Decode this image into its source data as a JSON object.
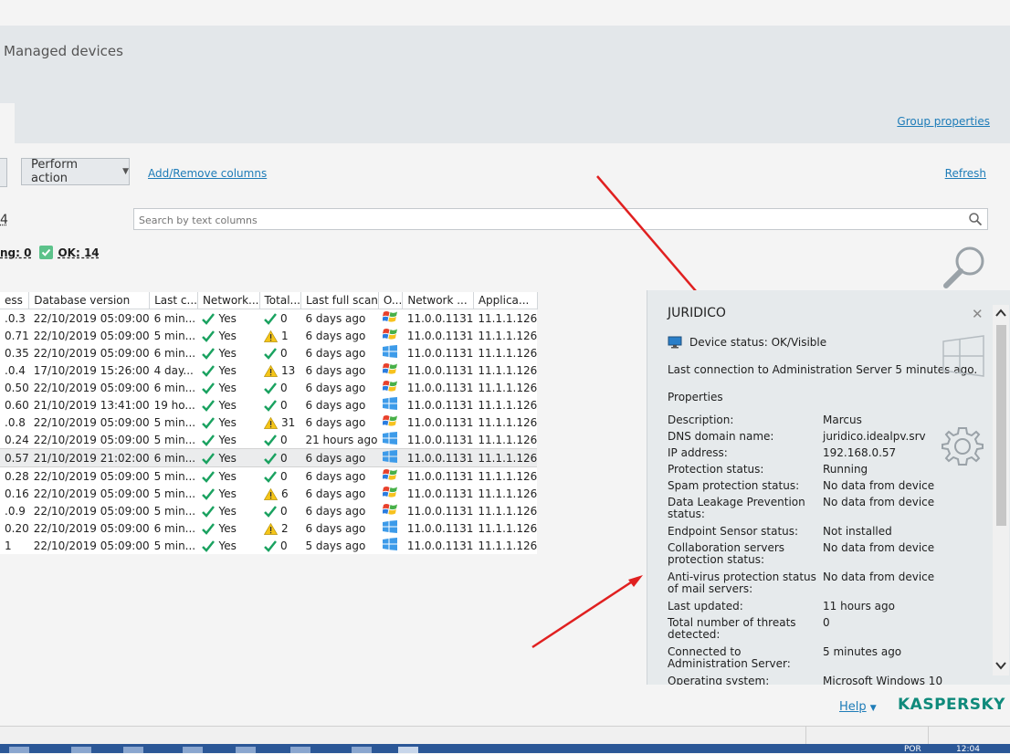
{
  "page": {
    "title": "Managed devices",
    "group_properties": "Group properties",
    "refresh": "Refresh"
  },
  "toolbar": {
    "perform_action": "Perform action",
    "add_remove_columns": "Add/Remove columns",
    "count_fragment": "4"
  },
  "search": {
    "placeholder": "Search by text columns"
  },
  "status_summary": {
    "warning_fragment": "ng: 0",
    "ok": "OK: 14"
  },
  "table": {
    "columns": [
      "ess",
      "Database version",
      "Last c...",
      "Network...",
      "Total...",
      "Last full scan",
      "O...",
      "Network ...",
      "Applica..."
    ],
    "rows": [
      {
        "addr": ".0.3",
        "db": "22/10/2019 05:09:00",
        "last": "6 min...",
        "net": "Yes",
        "st": "ok",
        "total": "0",
        "scan": "6 days ago",
        "os": "xp",
        "nagent": "11.0.0.1131",
        "app": "11.1.1.126"
      },
      {
        "addr": "0.71",
        "db": "22/10/2019 05:09:00",
        "last": "5 min...",
        "net": "Yes",
        "st": "warn",
        "total": "1",
        "scan": "6 days ago",
        "os": "xp",
        "nagent": "11.0.0.1131",
        "app": "11.1.1.126"
      },
      {
        "addr": "0.35",
        "db": "22/10/2019 05:09:00",
        "last": "6 min...",
        "net": "Yes",
        "st": "ok",
        "total": "0",
        "scan": "6 days ago",
        "os": "win10",
        "nagent": "11.0.0.1131",
        "app": "11.1.1.126"
      },
      {
        "addr": ".0.4",
        "db": "17/10/2019 15:26:00",
        "last": "4 day...",
        "net": "Yes",
        "st": "warn",
        "total": "13",
        "scan": "6 days ago",
        "os": "xp",
        "nagent": "11.0.0.1131",
        "app": "11.1.1.126"
      },
      {
        "addr": "0.50",
        "db": "22/10/2019 05:09:00",
        "last": "6 min...",
        "net": "Yes",
        "st": "ok",
        "total": "0",
        "scan": "6 days ago",
        "os": "xp",
        "nagent": "11.0.0.1131",
        "app": "11.1.1.126"
      },
      {
        "addr": "0.60",
        "db": "21/10/2019 13:41:00",
        "last": "19 ho...",
        "net": "Yes",
        "st": "ok",
        "total": "0",
        "scan": "6 days ago",
        "os": "win10",
        "nagent": "11.0.0.1131",
        "app": "11.1.1.126"
      },
      {
        "addr": ".0.8",
        "db": "22/10/2019 05:09:00",
        "last": "5 min...",
        "net": "Yes",
        "st": "warn",
        "total": "31",
        "scan": "6 days ago",
        "os": "xp",
        "nagent": "11.0.0.1131",
        "app": "11.1.1.126"
      },
      {
        "addr": "0.24",
        "db": "22/10/2019 05:09:00",
        "last": "5 min...",
        "net": "Yes",
        "st": "ok",
        "total": "0",
        "scan": "21 hours ago",
        "os": "win10",
        "nagent": "11.0.0.1131",
        "app": "11.1.1.126"
      },
      {
        "addr": "0.57",
        "db": "21/10/2019 21:02:00",
        "last": "6 min...",
        "net": "Yes",
        "st": "ok",
        "total": "0",
        "scan": "6 days ago",
        "os": "win10",
        "nagent": "11.0.0.1131",
        "app": "11.1.1.126",
        "selected": true
      },
      {
        "addr": "0.28",
        "db": "22/10/2019 05:09:00",
        "last": "5 min...",
        "net": "Yes",
        "st": "ok",
        "total": "0",
        "scan": "6 days ago",
        "os": "xp",
        "nagent": "11.0.0.1131",
        "app": "11.1.1.126"
      },
      {
        "addr": "0.16",
        "db": "22/10/2019 05:09:00",
        "last": "5 min...",
        "net": "Yes",
        "st": "warn",
        "total": "6",
        "scan": "6 days ago",
        "os": "xp",
        "nagent": "11.0.0.1131",
        "app": "11.1.1.126"
      },
      {
        "addr": ".0.9",
        "db": "22/10/2019 05:09:00",
        "last": "5 min...",
        "net": "Yes",
        "st": "ok",
        "total": "0",
        "scan": "6 days ago",
        "os": "xp",
        "nagent": "11.0.0.1131",
        "app": "11.1.1.126"
      },
      {
        "addr": "0.20",
        "db": "22/10/2019 05:09:00",
        "last": "6 min...",
        "net": "Yes",
        "st": "warn",
        "total": "2",
        "scan": "6 days ago",
        "os": "win10",
        "nagent": "11.0.0.1131",
        "app": "11.1.1.126"
      },
      {
        "addr": "1",
        "db": "22/10/2019 05:09:00",
        "last": "5 min...",
        "net": "Yes",
        "st": "ok",
        "total": "0",
        "scan": "5 days ago",
        "os": "win10",
        "nagent": "11.0.0.1131",
        "app": "11.1.1.126"
      }
    ]
  },
  "panel": {
    "title": "JURIDICO",
    "device_status": "Device status: OK/Visible",
    "last_connection": "Last connection to Administration Server 5 minutes ago.",
    "properties_heading": "Properties",
    "properties": [
      {
        "label": "Description:",
        "value": "Marcus"
      },
      {
        "label": "DNS domain name:",
        "value": "juridico.idealpv.srv"
      },
      {
        "label": "IP address:",
        "value": "192.168.0.57"
      },
      {
        "label": "Protection status:",
        "value": "Running"
      },
      {
        "label": "Spam protection status:",
        "value": "No data from device"
      },
      {
        "label": "Data Leakage Prevention status:",
        "value": "No data from device"
      },
      {
        "label": "Endpoint Sensor status:",
        "value": "Not installed"
      },
      {
        "label": "Collaboration servers protection status:",
        "value": "No data from device"
      },
      {
        "label": "Anti-virus protection status of mail servers:",
        "value": "No data from device"
      },
      {
        "label": "Last updated:",
        "value": "11 hours ago"
      },
      {
        "label": "Total number of threats detected:",
        "value": "0"
      },
      {
        "label": "Connected to Administration Server:",
        "value": "5 minutes ago"
      },
      {
        "label": "Operating system:",
        "value": "Microsoft Windows 10"
      }
    ]
  },
  "footer": {
    "help": "Help",
    "brand": "KASPERSKY"
  },
  "tray": {
    "lang": "POR",
    "time": "12:04"
  },
  "colors": {
    "accent_link": "#1e7cb8",
    "check_green": "#1aa260",
    "warn_yellow": "#f5c518",
    "brand_teal": "#0f8a7b",
    "arrow_red": "#e02020"
  }
}
